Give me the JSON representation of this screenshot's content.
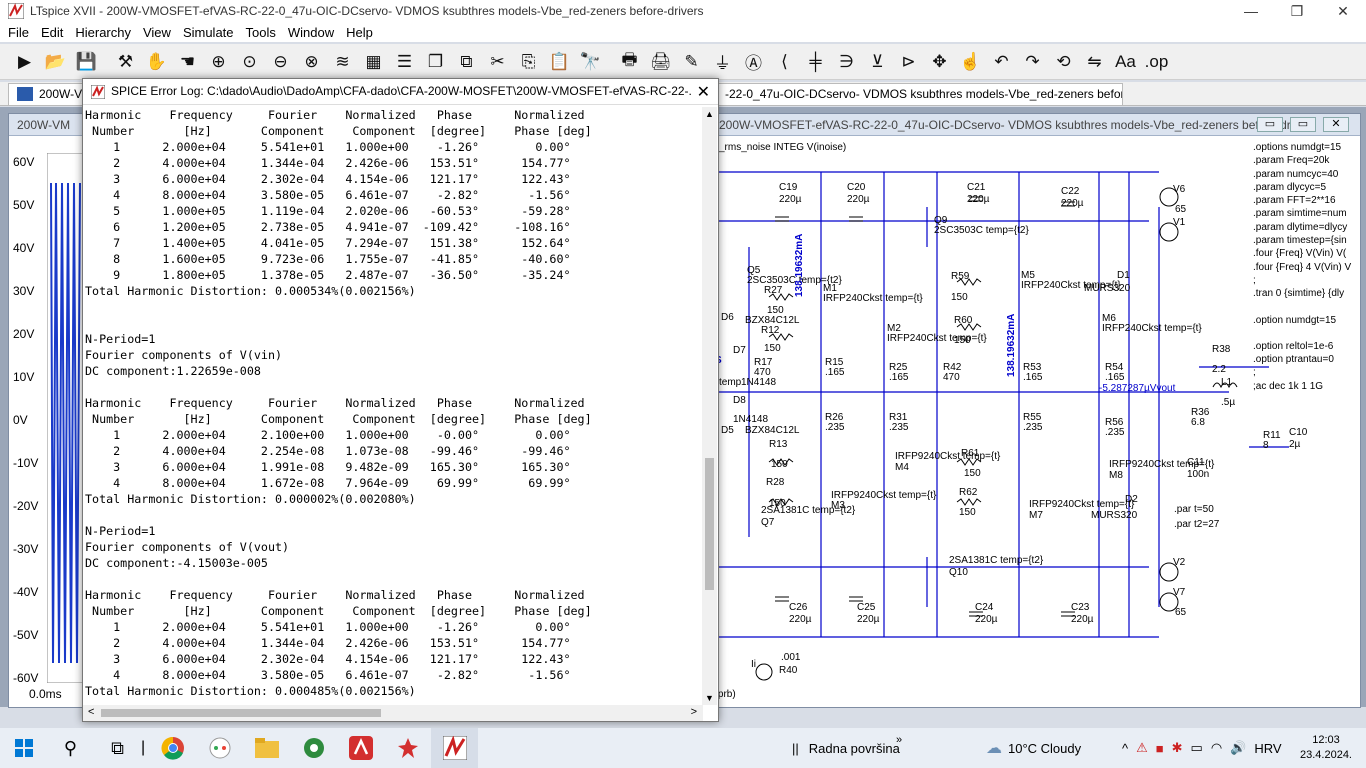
{
  "window": {
    "title": "LTspice XVII - 200W-VMOSFET-efVAS-RC-22-0_47u-OIC-DCservo- VDMOS ksubthres models-Vbe_red-zeners before-drivers",
    "minimize": "—",
    "maximize": "❐",
    "close": "✕"
  },
  "menu": [
    "File",
    "Edit",
    "Hierarchy",
    "View",
    "Simulate",
    "Tools",
    "Window",
    "Help"
  ],
  "toolbar_icons": [
    "run-icon",
    "open-icon",
    "save-icon",
    "control-panel-icon",
    "halt-icon",
    "pan-icon",
    "zoom-in-icon",
    "zoom-full-icon",
    "zoom-out-icon",
    "cancel-zoom-icon",
    "autorange-icon",
    "draw-grid-icon",
    "tile-horizontal-icon",
    "cascade-icon",
    "tile-vertical-icon",
    "cut-icon",
    "copy-icon",
    "paste-icon",
    "find-icon",
    "print-icon",
    "print-setup-icon",
    "pencil-icon",
    "ground-icon",
    "label-net-icon",
    "wire-icon",
    "resistor-icon",
    "capacitor-icon",
    "inductor-icon",
    "diode-icon",
    "component-icon",
    "move-icon",
    "drag-icon",
    "undo-icon",
    "redo-icon",
    "rotate-icon",
    "mirror-icon",
    "text-icon",
    "spice-directive-icon"
  ],
  "tabs": {
    "left": "200W-VMO",
    "right": "-22-0_47u-OIC-DCservo- VDMOS ksubthres models-Vbe_red-zeners before-drivers"
  },
  "schematic": {
    "title": "200W-VMOSFET-efVAS-RC-22-0_47u-OIC-DCservo- VDMOS ksubthres models-Vbe_red-zeners before-drivers",
    "title_left": "200W-VM",
    "btn_min": "▭",
    "btn_max": "▭",
    "btn_close": "✕",
    "plot_axis": [
      "60V",
      "50V",
      "40V",
      "30V",
      "20V",
      "10V",
      "0V",
      "-10V",
      "-20V",
      "-30V",
      "-40V",
      "-50V",
      "-60V"
    ],
    "plot_xstart": "0.0ms",
    "labels": {
      "integ": "_rms_noise INTEG V(inoise)",
      "c19": "C19",
      "c19v": "220µ",
      "c20": "C20",
      "c20v": "220µ",
      "c21": "C21",
      "c21v": "220µ",
      "c22": "C22",
      "c22v": "220µ",
      "q9": "Q9",
      "q9m": "2SC3503C temp={t2}",
      "q5": "Q5",
      "q5m": "2SC3503C temp={t2}",
      "r27": "R27",
      "r27v": "150",
      "m1": "M1",
      "m1m": "IRFP240Ckst temp={t}",
      "z1": "BZX84C12L",
      "r12": "R12",
      "r12v": "150",
      "m2": "M2",
      "m2m": "IRFP240Ckst temp={t}",
      "i1": "138.19632mA",
      "i2": "138.19632mA",
      "r59": "R59",
      "r59v": "150",
      "m5": "M5",
      "m5m": "IRFP240Ckst temp={t}",
      "r60": "R60",
      "r60v": "150",
      "m6": "M6",
      "m6m": "IRFP240Ckst temp={t}",
      "d1": "D1",
      "d1m": "MURS320",
      "d6": "D6",
      "d7": "D7",
      "d8": "D8",
      "r17": "R17",
      "r17v": "470",
      "d1n": "1N4148",
      "d1n2": "1N4148",
      "r15": "R15",
      "r15v": ".165",
      "r25": "R25",
      "r25v": ".165",
      "r42": "R42",
      "r42v": "470",
      "r53": "R53",
      "r53v": ".165",
      "r54": "R54",
      "r54v": ".165",
      "vout": "-5.287287µVvout",
      "r38": "R38",
      "r38v": "2.2",
      "l1": "L1",
      "l1v": ".5µ",
      "r36": "R36",
      "r36v": "6.8",
      "r11": "R11",
      "r11v": "8",
      "c10": "C10",
      "c10v": "2µ",
      "c11": "C11",
      "c11v": "100n",
      "r26": "R26",
      "r26v": ".235",
      "r31": "R31",
      "r31v": ".235",
      "r55": "R55",
      "r55v": ".235",
      "r56": "R56",
      "r56v": ".235",
      "z2": "BZX84C12L",
      "r13": "R13",
      "r13v": "150",
      "m4": "M4",
      "m4m": "IRFP9240Ckst temp={t}",
      "r61": "R61",
      "r61v": "150",
      "m8": "M8",
      "m8m": "IRFP9240Ckst temp={t}",
      "r28": "R28",
      "r28v": "150",
      "m3": "M3",
      "m3m": "IRFP9240Ckst temp={t}",
      "r62": "R62",
      "r62v": "150",
      "m7": "M7",
      "m7m": "IRFP9240Ckst temp={t}",
      "d2": "D2",
      "d2m": "MURS320",
      "q7": "Q7",
      "q7m": "2SA1381C temp={t2}",
      "q10": "Q10",
      "q10m": "2SA1381C temp={t2}",
      "par1": ".par t=50",
      "par2": ".par t2=27",
      "c26": "C26",
      "c26v": "220µ",
      "c25": "C25",
      "c25v": "220µ",
      "c24": "C24",
      "c24v": "220µ",
      "c23": "C23",
      "c23v": "220µ",
      "v6": "V6",
      "v6v": "65",
      "v1": "V1",
      "v2": "V2",
      "v7": "V7",
      "v7v": "65",
      "r40": "R40",
      "r40v": ".001",
      "ii": "Ii",
      "uprb": "u(prb)",
      "s": "S",
      "temp": "temp",
      "d5": "D5"
    },
    "directives": [
      ".options numdgt=15",
      ".param Freq=20k",
      ".param numcyc=40",
      ".param dlycyc=5",
      ".param FFT=2**16",
      ".param simtime=num",
      ".param dlytime=dlycy",
      ".param timestep={sin",
      ".four {Freq} V(Vin) V(",
      ".four {Freq} 4 V(Vin) V",
      ";",
      ".tran 0 {simtime} {dly",
      ".option numdgt=15",
      ".option reltol=1e-6",
      ".option ptrantau=0",
      ";",
      ";ac dec 1k 1 1G"
    ]
  },
  "error_log": {
    "title": "SPICE Error Log: C:\\dado\\Audio\\DadoAmp\\CFA-dado\\CFA-200W-MOSFET\\200W-VMOSFET-efVAS-RC-22-...",
    "close": "✕",
    "lines": [
      "Harmonic    Frequency     Fourier    Normalized   Phase      Normalized",
      " Number       [Hz]       Component    Component  [degree]    Phase [deg]",
      "    1      2.000e+04     5.541e+01   1.000e+00    -1.26°        0.00°",
      "    2      4.000e+04     1.344e-04   2.426e-06   153.51°      154.77°",
      "    3      6.000e+04     2.302e-04   4.154e-06   121.17°      122.43°",
      "    4      8.000e+04     3.580e-05   6.461e-07    -2.82°       -1.56°",
      "    5      1.000e+05     1.119e-04   2.020e-06   -60.53°      -59.28°",
      "    6      1.200e+05     2.738e-05   4.941e-07  -109.42°     -108.16°",
      "    7      1.400e+05     4.041e-05   7.294e-07   151.38°      152.64°",
      "    8      1.600e+05     9.723e-06   1.755e-07   -41.85°      -40.60°",
      "    9      1.800e+05     1.378e-05   2.487e-07   -36.50°      -35.24°",
      "Total Harmonic Distortion: 0.000534%(0.002156%)",
      "",
      "",
      "N-Period=1",
      "Fourier components of V(vin)",
      "DC component:1.22659e-008",
      "",
      "Harmonic    Frequency     Fourier    Normalized   Phase      Normalized",
      " Number       [Hz]       Component    Component  [degree]    Phase [deg]",
      "    1      2.000e+04     2.100e+00   1.000e+00    -0.00°        0.00°",
      "    2      4.000e+04     2.254e-08   1.073e-08   -99.46°      -99.46°",
      "    3      6.000e+04     1.991e-08   9.482e-09   165.30°      165.30°",
      "    4      8.000e+04     1.672e-08   7.964e-09    69.99°       69.99°",
      "Total Harmonic Distortion: 0.000002%(0.002080%)",
      "",
      "N-Period=1",
      "Fourier components of V(vout)",
      "DC component:-4.15003e-005",
      "",
      "Harmonic    Frequency     Fourier    Normalized   Phase      Normalized",
      " Number       [Hz]       Component    Component  [degree]    Phase [deg]",
      "    1      2.000e+04     5.541e+01   1.000e+00    -1.26°        0.00°",
      "    2      4.000e+04     1.344e-04   2.426e-06   153.51°      154.77°",
      "    3      6.000e+04     2.302e-04   4.154e-06   121.17°      122.43°",
      "    4      8.000e+04     3.580e-05   6.461e-07    -2.82°       -1.56°",
      "Total Harmonic Distortion: 0.000485%(0.002156%)"
    ],
    "scroll_up": "▲",
    "scroll_down": "▼",
    "scroll_left": "<",
    "scroll_right": ">"
  },
  "taskbar": {
    "desktop_label": "Radna površina",
    "chevron": "»",
    "weather": "10°C  Cloudy",
    "tray_chevron": "^",
    "lang": "HRV",
    "time": "12:03",
    "date": "23.4.2024.",
    "pinned": [
      "start-icon",
      "search-icon",
      "task-view-icon",
      "chrome-icon",
      "meet-icon",
      "file-explorer-icon",
      "app-green-icon",
      "app-red-a-icon",
      "app-redbug-icon",
      "ltspice-icon"
    ]
  },
  "colors": {
    "wire": "#0000cc",
    "plot_bg": "#000000",
    "trace": "#1a3ac9",
    "accent": "#cc2222"
  }
}
